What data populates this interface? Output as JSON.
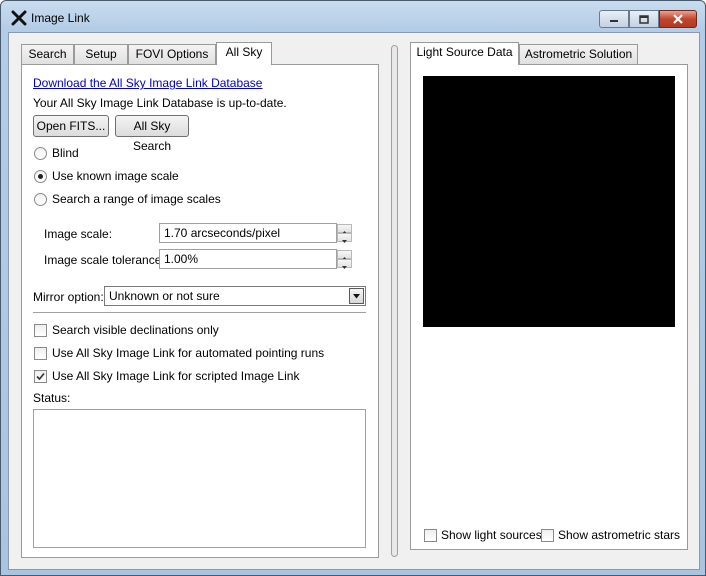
{
  "window": {
    "title": "Image Link",
    "icon": "telescope-x-icon"
  },
  "left_tabs": [
    {
      "label": "Search",
      "active": false
    },
    {
      "label": "Setup",
      "active": false
    },
    {
      "label": "FOVI Options",
      "active": false
    },
    {
      "label": "All Sky",
      "active": true
    }
  ],
  "all_sky": {
    "download_link": "Download the All Sky Image Link Database",
    "db_status": "Your All Sky Image Link Database is up-to-date.",
    "open_fits_button": "Open FITS...",
    "all_sky_search_button": "All Sky Search",
    "scale_modes": [
      {
        "label": "Blind",
        "selected": false
      },
      {
        "label": "Use known image scale",
        "selected": true
      },
      {
        "label": "Search a range of image scales",
        "selected": false
      }
    ],
    "image_scale_label": "Image scale:",
    "image_scale_value": "1.70 arcseconds/pixel",
    "tolerance_label": "Image scale tolerance:",
    "tolerance_value": "1.00%",
    "mirror_label": "Mirror option:",
    "mirror_value": "Unknown or not sure",
    "options": [
      {
        "label": "Search visible declinations only",
        "checked": false
      },
      {
        "label": "Use All Sky Image Link for automated pointing runs",
        "checked": false
      },
      {
        "label": "Use All Sky Image Link for scripted Image Link",
        "checked": true
      }
    ],
    "status_label": "Status:",
    "status_text": ""
  },
  "right_tabs": [
    {
      "label": "Light Source Data",
      "active": true
    },
    {
      "label": "Astrometric Solution",
      "active": false
    }
  ],
  "right_panel": {
    "show_light_sources_label": "Show light sources",
    "show_light_sources_checked": false,
    "show_astrometric_stars_label": "Show astrometric stars",
    "show_astrometric_stars_checked": false
  },
  "colors": {
    "link": "#0000cc",
    "image_background": "#000000",
    "close_button": "#c2452e"
  }
}
